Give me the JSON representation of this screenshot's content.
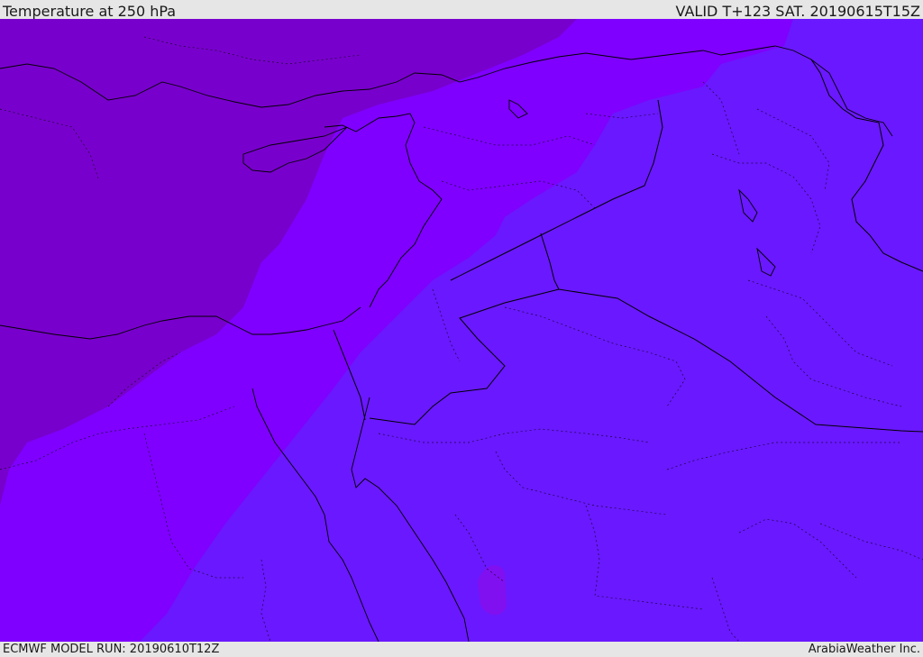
{
  "header": {
    "title": "Temperature at 250 hPa",
    "valid_time": "VALID T+123 SAT. 20190615T15Z"
  },
  "footer": {
    "model_run": "ECMWF MODEL RUN: 20190610T12Z",
    "credit": "ArabiaWeather Inc."
  },
  "map": {
    "colors": {
      "coldest_band": "#7800cc",
      "mid_band": "#7f00fe",
      "warm_band": "#6a18ff",
      "warm_patch": "#8010f0",
      "borders": "#000000"
    }
  }
}
